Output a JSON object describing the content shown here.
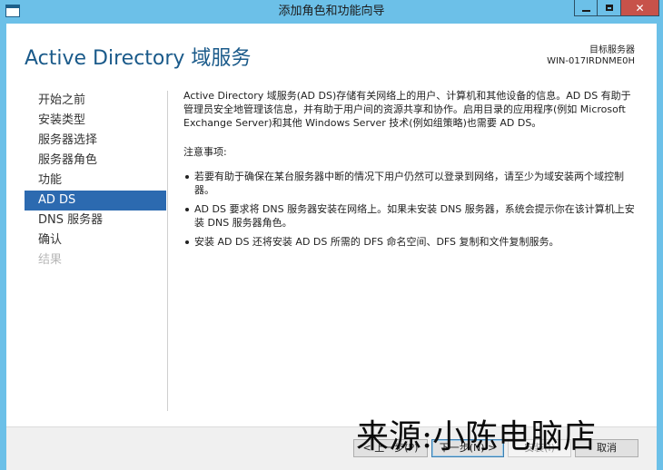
{
  "window": {
    "title": "添加角色和功能向导",
    "caption": {
      "minimize": "minimize",
      "maximize": "maximize",
      "close": "✕"
    }
  },
  "header": {
    "page_title": "Active Directory 域服务",
    "destination_label": "目标服务器",
    "destination_server": "WIN-017IRDNME0H"
  },
  "nav": {
    "items": [
      {
        "label": "开始之前",
        "state": "normal"
      },
      {
        "label": "安装类型",
        "state": "normal"
      },
      {
        "label": "服务器选择",
        "state": "normal"
      },
      {
        "label": "服务器角色",
        "state": "normal"
      },
      {
        "label": "功能",
        "state": "normal"
      },
      {
        "label": "AD DS",
        "state": "active"
      },
      {
        "label": "DNS 服务器",
        "state": "normal"
      },
      {
        "label": "确认",
        "state": "normal"
      },
      {
        "label": "结果",
        "state": "disabled"
      }
    ]
  },
  "content": {
    "intro": "Active Directory 域服务(AD DS)存储有关网络上的用户、计算机和其他设备的信息。AD DS 有助于管理员安全地管理该信息，并有助于用户间的资源共享和协作。启用目录的应用程序(例如 Microsoft Exchange Server)和其他 Windows Server 技术(例如组策略)也需要 AD DS。",
    "notes_label": "注意事项:",
    "notes": [
      "若要有助于确保在某台服务器中断的情况下用户仍然可以登录到网络，请至少为域安装两个域控制器。",
      "AD DS 要求将 DNS 服务器安装在网络上。如果未安装 DNS 服务器，系统会提示你在该计算机上安装 DNS 服务器角色。",
      "安装 AD DS 还将安装 AD DS 所需的 DFS 命名空间、DFS 复制和文件复制服务。"
    ]
  },
  "footer": {
    "prev_label": "< 上一步(P)",
    "next_label": "下一步(N) >",
    "install_label": "安装(I)",
    "cancel_label": "取消"
  },
  "watermark": "来源:小陈电脑店",
  "colors": {
    "titlebar": "#6cc0e8",
    "title_text": "#1a5a8a",
    "nav_active": "#2c6ab0",
    "close_button": "#c7524a"
  }
}
